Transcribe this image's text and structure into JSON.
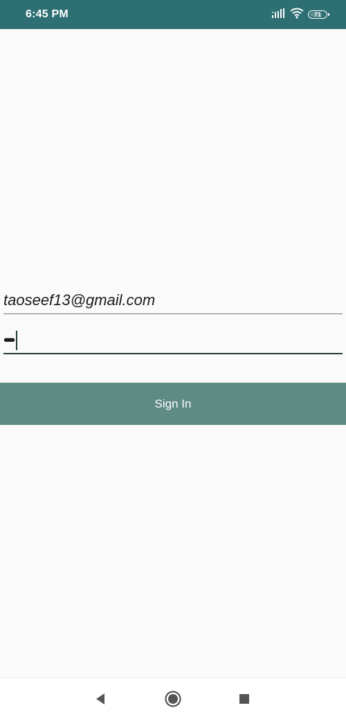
{
  "status_bar": {
    "time": "6:45 PM",
    "battery_level": "71",
    "icons": [
      "signal-icon",
      "wifi-icon",
      "battery-icon"
    ],
    "background": "#2e6f73"
  },
  "form": {
    "email_value": "taoseef13@gmail.com",
    "password_masked": "••••••"
  },
  "sign_in_button": {
    "label": "Sign In",
    "background": "#5f8b85"
  },
  "navigation_bar": {
    "buttons": [
      "back-icon",
      "home-icon",
      "recents-icon"
    ]
  },
  "colors": {
    "page_background": "#fafafa",
    "active_underline": "#1f3a38"
  }
}
